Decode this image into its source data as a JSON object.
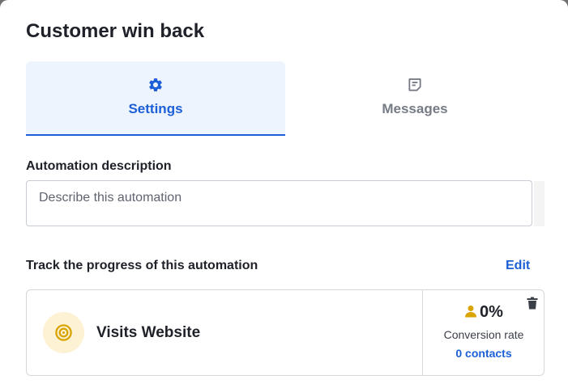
{
  "header": {
    "title": "Customer win back"
  },
  "tabs": [
    {
      "label": "Settings",
      "icon": "gear-icon",
      "active": true
    },
    {
      "label": "Messages",
      "icon": "message-icon",
      "active": false
    }
  ],
  "description": {
    "label": "Automation description",
    "placeholder": "Describe this automation",
    "value": ""
  },
  "tracking": {
    "label": "Track the progress of this automation",
    "edit_label": "Edit"
  },
  "goal_card": {
    "icon": "target-icon",
    "name": "Visits Website",
    "rate_value": "0%",
    "rate_label": "Conversion rate",
    "contacts_label": "0 contacts",
    "delete_icon": "trash-icon"
  },
  "colors": {
    "accent": "#1c5fd6",
    "active_tab_bg": "#eef4fd",
    "goal_icon_bg": "#fdf2d3",
    "goal_icon": "#d9a400",
    "text_primary": "#1f2129",
    "text_muted": "#767b86"
  }
}
